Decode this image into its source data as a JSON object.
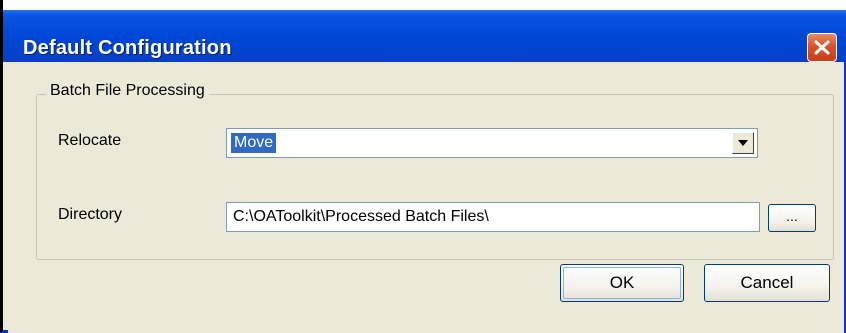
{
  "window": {
    "title": "Default Configuration"
  },
  "icons": {
    "close": "close-icon",
    "dropdown": "chevron-down-icon"
  },
  "colors": {
    "titlebar": "#0048d8",
    "close_button": "#d8522c",
    "dialog_background": "#ece9d8",
    "selection_highlight": "#316ac5"
  },
  "group": {
    "label": "Batch File Processing",
    "relocate": {
      "label": "Relocate",
      "value": "Move"
    },
    "directory": {
      "label": "Directory",
      "value": "C:\\OAToolkit\\Processed Batch Files\\",
      "browse_label": "..."
    }
  },
  "buttons": {
    "ok_label": "OK",
    "cancel_label": "Cancel"
  }
}
